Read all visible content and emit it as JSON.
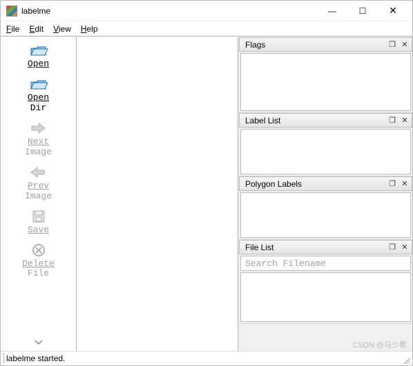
{
  "window": {
    "title": "labelme",
    "minimize": "—",
    "maximize": "☐",
    "close": "✕"
  },
  "menu": {
    "file": "File",
    "edit": "Edit",
    "view": "View",
    "help": "Help"
  },
  "toolbar": {
    "open": "Open",
    "open_dir_l1": "Open",
    "open_dir_l2": "Dir",
    "next_l1": "Next",
    "next_l2": "Image",
    "prev_l1": "Prev",
    "prev_l2": "Image",
    "save": "Save",
    "delete_l1": "Delete",
    "delete_l2": "File"
  },
  "panels": {
    "flags": "Flags",
    "labellist": "Label List",
    "polylabels": "Polygon Labels",
    "filelist": "File List",
    "search_placeholder": "Search Filename"
  },
  "status": {
    "text": "labelme started."
  },
  "watermark": "CSDN @马少希"
}
